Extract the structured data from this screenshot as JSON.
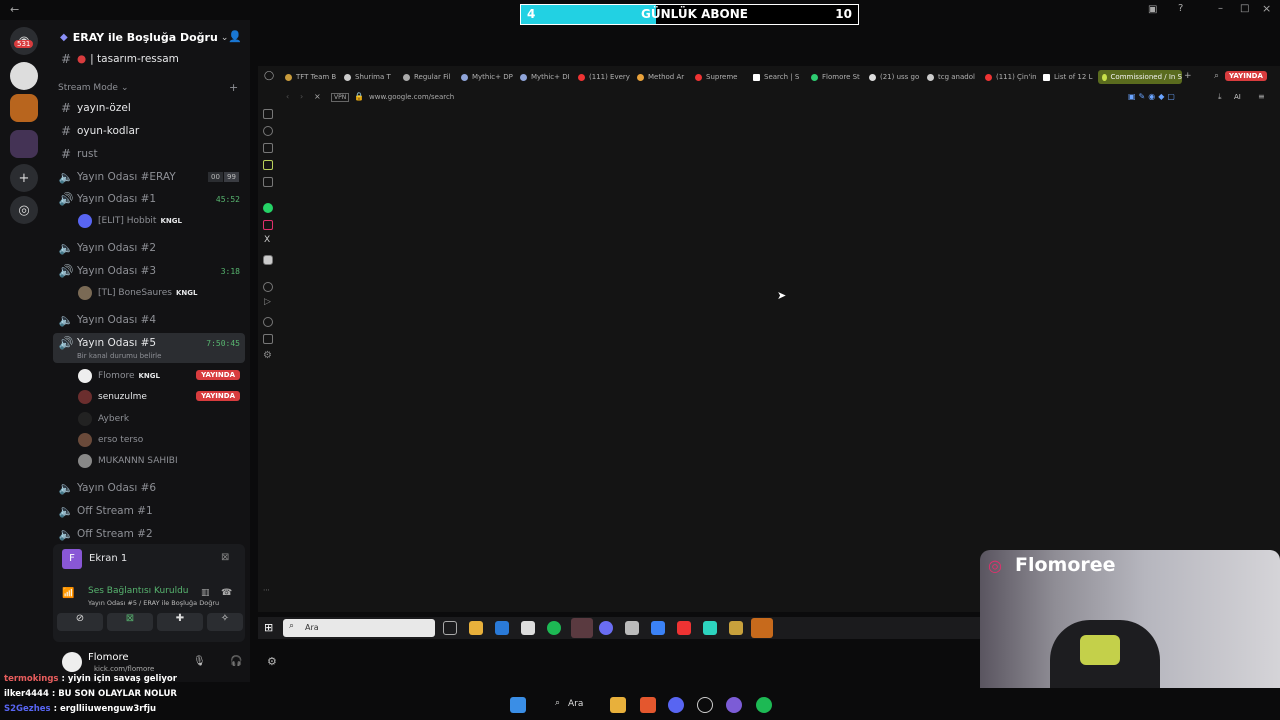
{
  "stream_overlay": {
    "goal_current": "4",
    "goal_label": "GÜNLÜK ABONE",
    "goal_target": "10",
    "goal_progress": 0.4
  },
  "discord": {
    "server_badge": "531",
    "server_name": "ERAY ile Boşluğa Doğru",
    "channels_top": [
      {
        "name": "| tasarım-ressam"
      }
    ],
    "category": "Stream Mode",
    "channels": [
      {
        "name": "yayın-özel",
        "bright": true
      },
      {
        "name": "oyun-kodlar",
        "bright": true
      },
      {
        "name": "rust",
        "bright": false
      }
    ],
    "voice": [
      {
        "name": "Yayın Odası #ERAY",
        "time": "00",
        "extra": "99"
      },
      {
        "name": "Yayın Odası #1",
        "time": "45:52",
        "users": [
          {
            "name": "[ELIT] Hobbit",
            "tag": "KNGL"
          }
        ]
      },
      {
        "name": "Yayın Odası #2",
        "time": ""
      },
      {
        "name": "Yayın Odası #3",
        "time": "3:18",
        "users": [
          {
            "name": "[TL] BoneSaures",
            "tag": "KNGL"
          }
        ]
      },
      {
        "name": "Yayın Odası #4",
        "time": ""
      },
      {
        "name": "Yayın Odası #5",
        "time": "7:50:45",
        "status": "Bir kanal durumu belirle"
      },
      {
        "name": "Yayın Odası #6",
        "time": ""
      },
      {
        "name": "Off Stream #1",
        "time": ""
      },
      {
        "name": "Off Stream #2",
        "time": ""
      }
    ],
    "room5_users": [
      {
        "name": "Flomore",
        "tag": "KNGL",
        "live": "YAYINDA"
      },
      {
        "name": "senuzulme",
        "tag": "",
        "live": "YAYINDA"
      },
      {
        "name": "Ayberk",
        "tag": "",
        "live": ""
      },
      {
        "name": "erso terso",
        "tag": "",
        "live": ""
      },
      {
        "name": "MUKANNN SAHIBI",
        "tag": "",
        "live": ""
      }
    ],
    "screen_share": "Ekran 1",
    "voice_status": "Ses Bağlantısı Kuruldu",
    "voice_location": "Yayın Odası #5 / ERAY ile Boşluğa Doğru",
    "user_name": "Flomore",
    "user_status": "kick.com/flomore"
  },
  "chat": [
    {
      "user": "termokings",
      "message": "yiyin için savaş geliyor"
    },
    {
      "user": "ilker4444",
      "message": "BU SON OLAYLAR NOLUR"
    },
    {
      "user": "S2Gezhes",
      "message": "erglliiuwenguw3rfju"
    }
  ],
  "browser": {
    "tabs": [
      "TFT Team B",
      "Shurima T",
      "Regular Fil",
      "Mythic+ DP",
      "Mythic+ DI",
      "(111) Every",
      "Method Ar",
      "Supreme",
      "Search | S",
      "Flomore St",
      "(21) uss go",
      "tcg anadol",
      "(111) Çin'in",
      "List of 12 L",
      "Commissioned / In S"
    ],
    "live_badge": "YAYINDA",
    "vpn": "VPN",
    "url": "www.google.com/search",
    "ai_label": "AI"
  },
  "inner_taskbar": {
    "search_placeholder": "Ara"
  },
  "os_taskbar": {
    "search_label": "Ara"
  },
  "webcam": {
    "handle": "Flomoree"
  },
  "colors": {
    "accent": "#22d1e3",
    "live": "#d83c3e",
    "voice_green": "#57b46f"
  }
}
